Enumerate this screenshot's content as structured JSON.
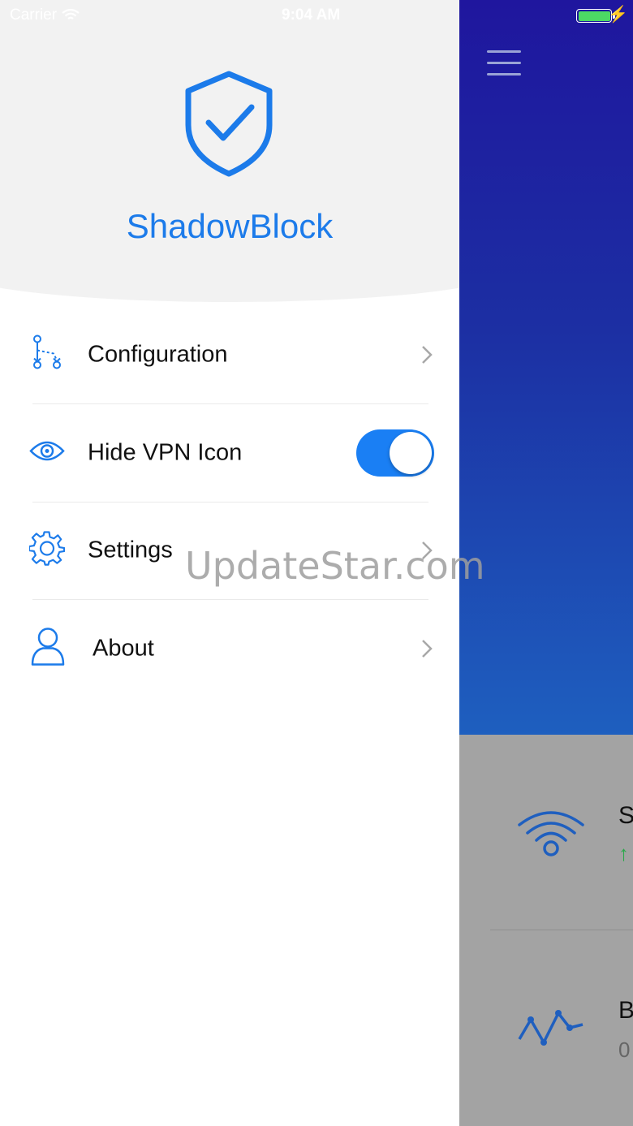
{
  "status_bar": {
    "carrier": "Carrier",
    "time": "9:04 AM"
  },
  "drawer": {
    "app_name": "ShadowBlock",
    "logo_icon": "shield-check-icon",
    "accent_color": "#1c7bea",
    "menu": [
      {
        "label": "Configuration",
        "icon": "route-nodes-icon",
        "control": "chevron"
      },
      {
        "label": "Hide VPN Icon",
        "icon": "eye-icon",
        "control": "toggle",
        "toggle_on": true
      },
      {
        "label": "Settings",
        "icon": "gear-icon",
        "control": "chevron"
      },
      {
        "label": "About",
        "icon": "person-icon",
        "control": "chevron"
      }
    ]
  },
  "main": {
    "menu_icon": "hamburger-icon",
    "cards": [
      {
        "icon": "wifi-icon",
        "title_initial": "S",
        "sub": "↑"
      },
      {
        "icon": "bandwidth-graph-icon",
        "title_initial": "B",
        "sub": "0"
      }
    ],
    "gradient_top": "#1f169e",
    "gradient_bottom": "#1e5fbf"
  },
  "watermark": "UpdateStar.com"
}
